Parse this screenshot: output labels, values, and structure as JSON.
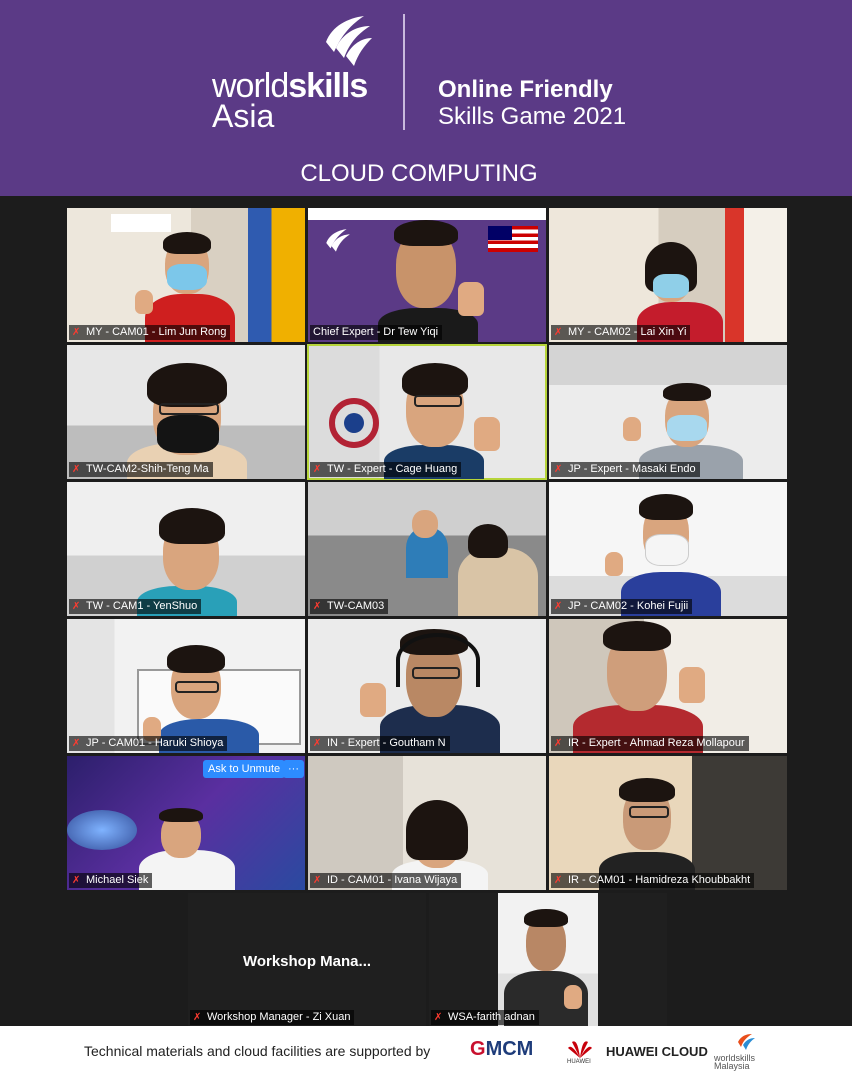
{
  "header": {
    "logo_world": "world",
    "logo_skills": "skills",
    "logo_asia": "Asia",
    "event_line1": "Online Friendly",
    "event_line2": "Skills Game 2021",
    "title": "CLOUD COMPUTING"
  },
  "participants": [
    {
      "name": "MY - CAM01 - Lim Jun Rong",
      "muted": true
    },
    {
      "name": "Chief Expert - Dr Tew Yiqi",
      "muted": false
    },
    {
      "name": "MY - CAM02 - Lai Xin Yi",
      "muted": true
    },
    {
      "name": "TW-CAM2-Shih-Teng Ma",
      "muted": true
    },
    {
      "name": "TW - Expert - Cage Huang",
      "muted": true,
      "active_speaker": true
    },
    {
      "name": "JP - Expert - Masaki Endo",
      "muted": true
    },
    {
      "name": "TW - CAM1 - YenShuo",
      "muted": true
    },
    {
      "name": "TW-CAM03",
      "muted": true
    },
    {
      "name": "JP - CAM02 - Kohei Fujii",
      "muted": true
    },
    {
      "name": "JP - CAM01 - Haruki Shioya",
      "muted": true
    },
    {
      "name": "IN - Expert - Goutham N",
      "muted": true
    },
    {
      "name": "IR - Expert - Ahmad Reza Mollapour",
      "muted": true
    },
    {
      "name": "Michael Siek",
      "muted": true
    },
    {
      "name": "ID - CAM01 - Ivana Wijaya",
      "muted": true
    },
    {
      "name": "IR - CAM01 - Hamidreza Khoubbakht",
      "muted": true
    },
    {
      "name": "Workshop Manager - Zi Xuan",
      "muted": true,
      "video_off_label": "Workshop  Mana..."
    },
    {
      "name": "WSA-farith adnan",
      "muted": true
    }
  ],
  "controls": {
    "ask_to_unmute": "Ask to Unmute",
    "more_options": "···"
  },
  "footer": {
    "support_text": "Technical materials and cloud facilities are supported by",
    "gmcm_g": "G",
    "gmcm_rest": "MCM",
    "huawei_small": "HUAWEI",
    "huawei_cloud": "HUAWEI CLOUD",
    "ws_malaysia_1": "worldskills",
    "ws_malaysia_2": "Malaysia"
  },
  "colors": {
    "header_bg": "#5b3a86",
    "grid_bg": "#1c1c1c",
    "active_speaker_border": "#b6d43a",
    "mic_muted": "#ff3b30",
    "zoom_blue": "#2d8cff"
  }
}
